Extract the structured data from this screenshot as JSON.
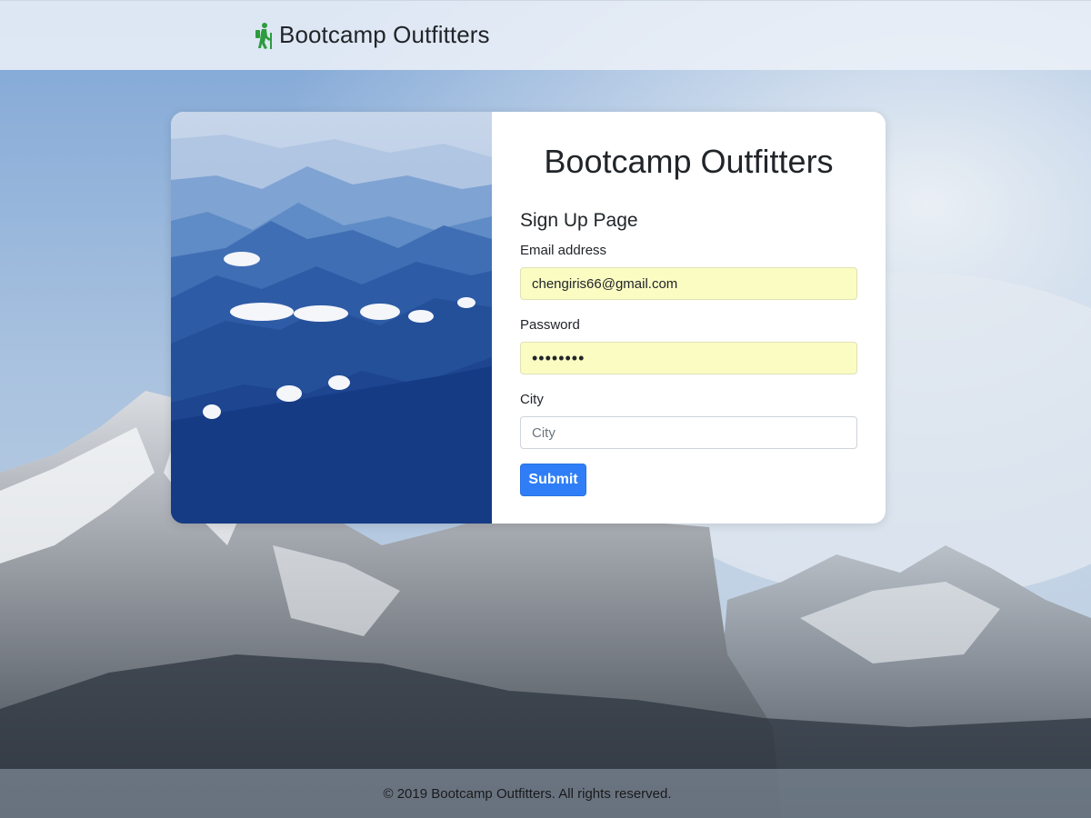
{
  "navbar": {
    "brand_name": "Bootcamp Outfitters",
    "brand_icon": "hiking-person-icon",
    "brand_icon_color": "#2e9b3f"
  },
  "card": {
    "title": "Bootcamp Outfitters",
    "form_heading": "Sign Up Page",
    "email": {
      "label": "Email address",
      "value": "chengiris66@gmail.com"
    },
    "password": {
      "label": "Password",
      "value": "••••••••"
    },
    "city": {
      "label": "City",
      "placeholder": "City",
      "value": ""
    },
    "submit_label": "Submit"
  },
  "footer": {
    "text": "© 2019 Bootcamp Outfitters. All rights reserved."
  },
  "colors": {
    "primary_button": "#2f7ef7",
    "autofill_background": "#fafcc2",
    "card_background": "#ffffff"
  }
}
